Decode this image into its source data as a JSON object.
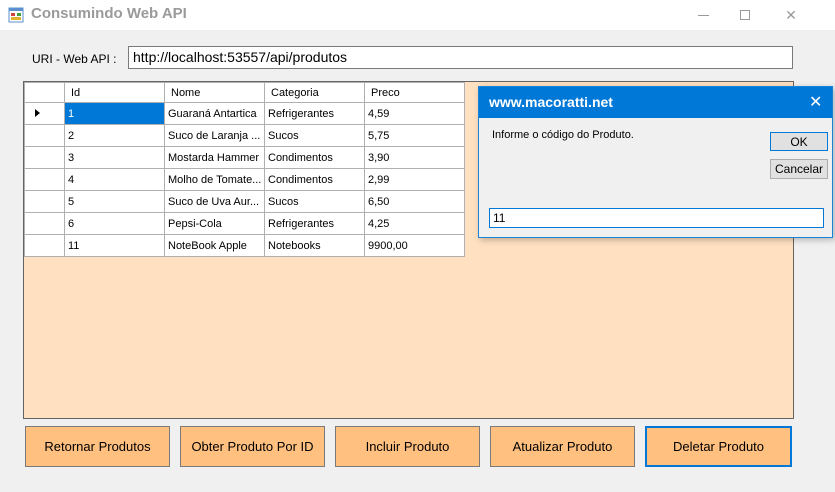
{
  "window": {
    "title": "Consumindo Web API",
    "icon": "app-form-icon",
    "controls": {
      "minimize": "minimize-icon",
      "maximize": "maximize-icon",
      "close": "✕"
    }
  },
  "uri": {
    "label": "URI - Web API :",
    "value": "http://localhost:53557/api/produtos"
  },
  "grid": {
    "columns": [
      "Id",
      "Nome",
      "Categoria",
      "Preco"
    ],
    "rows": [
      {
        "id": "1",
        "nome": "Guaraná Antartica",
        "categoria": "Refrigerantes",
        "preco": "4,59"
      },
      {
        "id": "2",
        "nome": "Suco de Laranja ...",
        "categoria": "Sucos",
        "preco": "5,75"
      },
      {
        "id": "3",
        "nome": "Mostarda Hammer",
        "categoria": "Condimentos",
        "preco": "3,90"
      },
      {
        "id": "4",
        "nome": "Molho de Tomate...",
        "categoria": "Condimentos",
        "preco": "2,99"
      },
      {
        "id": "5",
        "nome": "Suco de Uva Aur...",
        "categoria": "Sucos",
        "preco": "6,50"
      },
      {
        "id": "6",
        "nome": "Pepsi-Cola",
        "categoria": "Refrigerantes",
        "preco": "4,25"
      },
      {
        "id": "11",
        "nome": "NoteBook Apple",
        "categoria": "Notebooks",
        "preco": "9900,00"
      }
    ],
    "panel_color": "#ffe0c0",
    "selection_color": "#0078d7"
  },
  "buttons": {
    "retornar": "Retornar Produtos",
    "obter": "Obter Produto Por ID",
    "incluir": "Incluir Produto",
    "atualizar": "Atualizar Produto",
    "deletar": "Deletar Produto",
    "color": "#ffc080"
  },
  "dialog": {
    "title": "www.macoratti.net",
    "close": "✕",
    "prompt": "Informe o código do Produto.",
    "ok": "OK",
    "cancel": "Cancelar",
    "input_value": "11",
    "title_color": "#0078d7"
  }
}
